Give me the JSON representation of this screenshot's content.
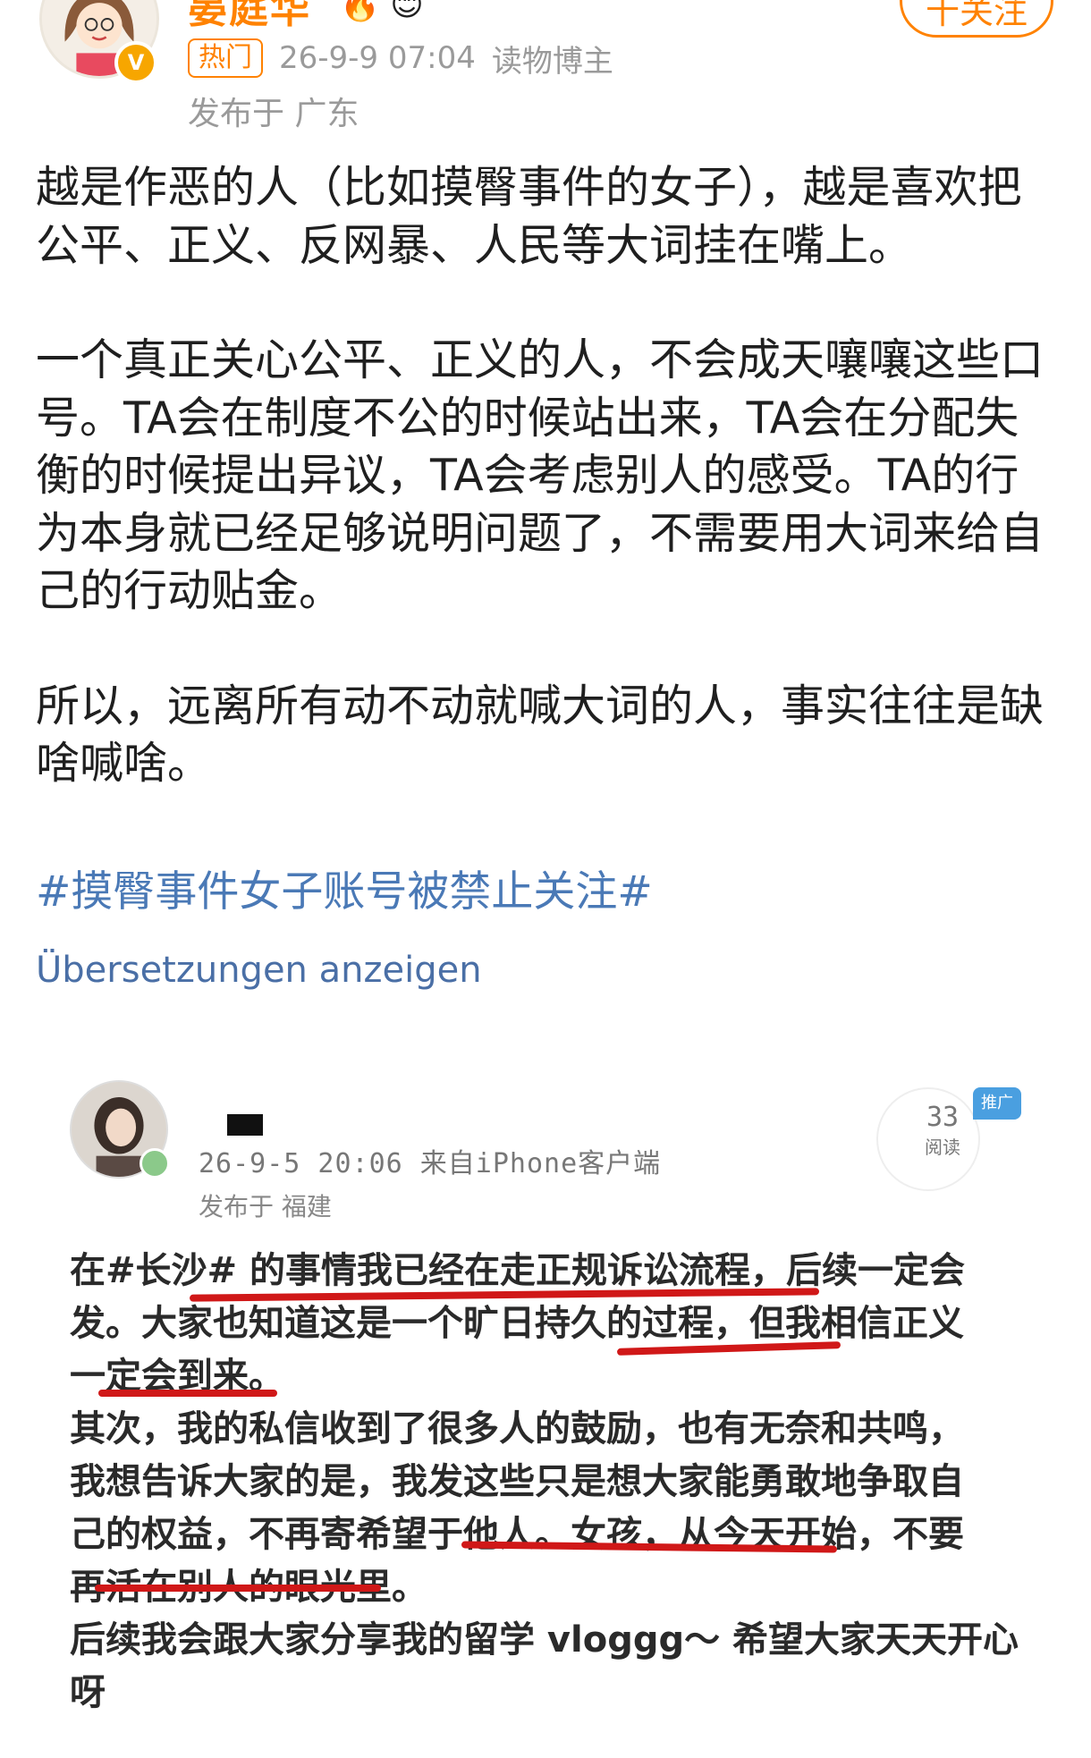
{
  "post": {
    "username": "晏庭华",
    "username_badges": "🔥 😊",
    "follow_label": "十关注",
    "hot_label": "热门",
    "time": "26-9-9 07:04",
    "category": "读物博主",
    "location": "发布于 广东",
    "paragraphs": [
      "越是作恶的人（比如摸臀事件的女子），越是喜欢把\n公平、正义、反网暴、人民等大词挂在嘴上。",
      "一个真正关心公平、正义的人，不会成天嚷嚷这些口\n号。TA会在制度不公的时候站出来，TA会在分配失\n衡的时候提出异议，TA会考虑别人的感受。TA的行\n为本身就已经足够说明问题了，不需要用大词来给自\n己的行动贴金。",
      "所以，远离所有动不动就喊大词的人，事实往往是缺\n啥喊啥。"
    ],
    "hashtag": "#摸臀事件女子账号被禁止关注#",
    "translate_label": "Übersetzungen anzeigen",
    "verified_mark": "V"
  },
  "embedded": {
    "time_source": "26-9-5 20:06  来自iPhone客户端",
    "location": "发布于 福建",
    "reads_count": "33",
    "reads_label": "阅读",
    "promo_tag": "推广",
    "text": "在#长沙# 的事情我已经在走正规诉讼流程，后续一定会\n发。大家也知道这是一个旷日持久的过程，但我相信正义\n一定会到来。\n其次，我的私信收到了很多人的鼓励，也有无奈和共鸣，\n我想告诉大家的是，我发这些只是想大家能勇敢地争取自\n己的权益，不再寄希望于他人。女孩，从今天开始，不要\n再活在别人的眼光里。\n后续我会跟大家分享我的留学 vloggg～ 希望大家天天开心\n呀"
  },
  "colors": {
    "accent": "#ff8200",
    "link": "#4a79b6",
    "underline": "#d01818"
  }
}
